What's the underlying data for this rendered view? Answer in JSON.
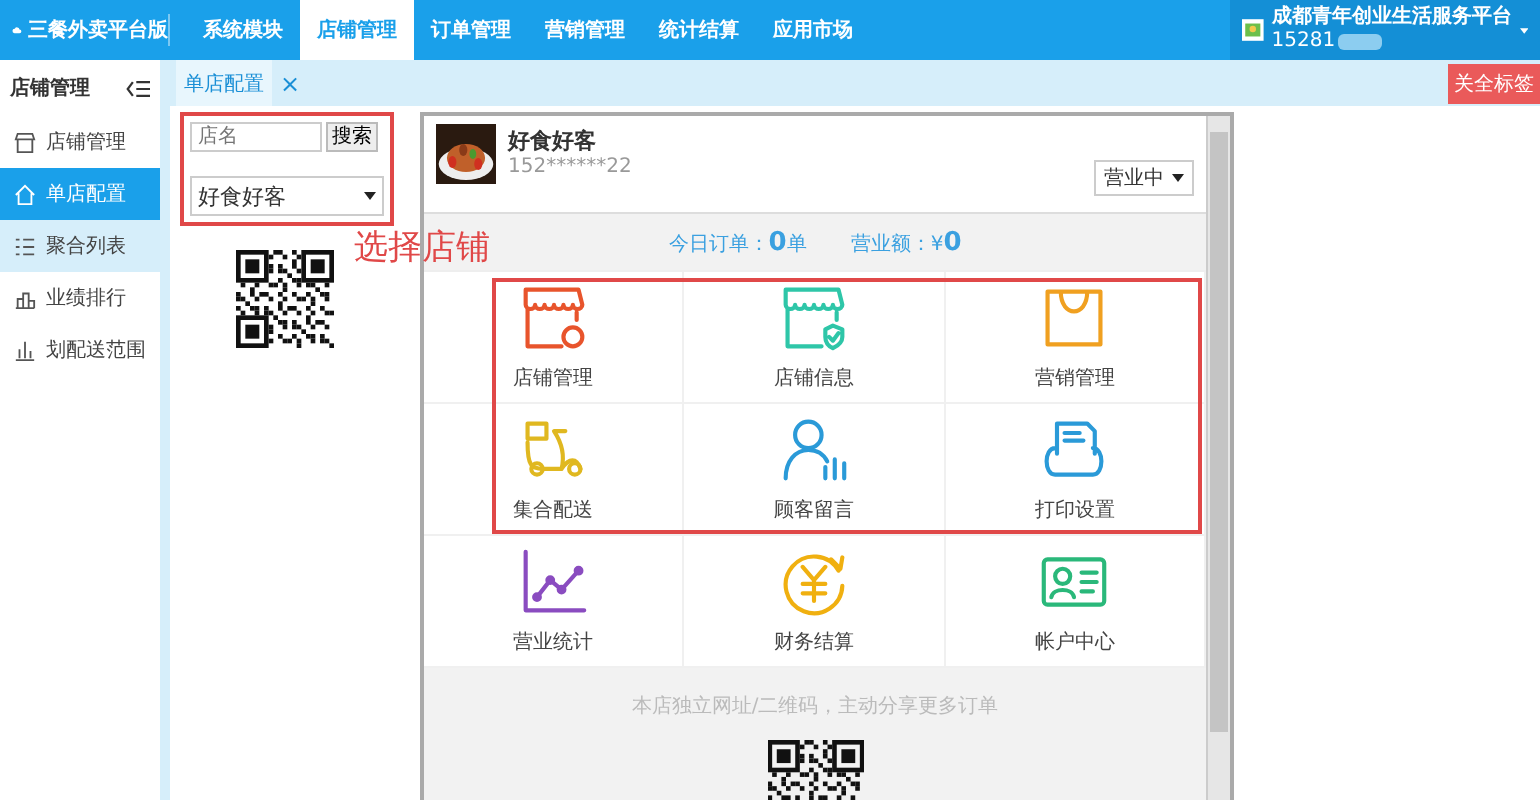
{
  "topbar": {
    "brand": "三餐外卖平台版",
    "nav": [
      {
        "label": "系统模块",
        "selected": false
      },
      {
        "label": "店铺管理",
        "selected": true
      },
      {
        "label": "订单管理",
        "selected": false
      },
      {
        "label": "营销管理",
        "selected": false
      },
      {
        "label": "统计结算",
        "selected": false
      },
      {
        "label": "应用市场",
        "selected": false
      }
    ],
    "user": {
      "name": "成都青年创业生活服务平台",
      "phone": "15281"
    }
  },
  "sidebar": {
    "title": "店铺管理",
    "items": [
      {
        "label": "店铺管理",
        "kind": "store",
        "selected": false,
        "hovered": false
      },
      {
        "label": "单店配置",
        "kind": "home",
        "selected": true,
        "hovered": false
      },
      {
        "label": "聚合列表",
        "kind": "list",
        "selected": false,
        "hovered": true
      },
      {
        "label": "业绩排行",
        "kind": "rank",
        "selected": false,
        "hovered": false
      },
      {
        "label": "划配送范围",
        "kind": "bars",
        "selected": false,
        "hovered": false
      }
    ]
  },
  "tabs": [
    {
      "label": "单店配置",
      "close": "×",
      "selected": true
    }
  ],
  "close_all": "关全标签",
  "picker": {
    "placeholder": "店名",
    "search": "搜索",
    "store": "好食好客"
  },
  "annotation": "选择店铺",
  "preview": {
    "name": "好食好客",
    "phone": "152******22",
    "status": "营业中",
    "stats": [
      {
        "label": "今日订单：",
        "value": "0",
        "unit": "单"
      },
      {
        "label": "营业额：¥",
        "value": "0"
      }
    ],
    "grid": [
      {
        "label": "店铺管理",
        "kind": "store",
        "color": "#e8542c"
      },
      {
        "label": "店铺信息",
        "kind": "shopinfo",
        "color": "#2ec6a8"
      },
      {
        "label": "营销管理",
        "kind": "bag",
        "color": "#f0a020"
      },
      {
        "label": "集合配送",
        "kind": "scooter",
        "color": "#e0b820"
      },
      {
        "label": "顾客留言",
        "kind": "customer",
        "color": "#2a9ad8"
      },
      {
        "label": "打印设置",
        "kind": "printer",
        "color": "#2a9ad8"
      },
      {
        "label": "营业统计",
        "kind": "chart",
        "color": "#8a4cc0"
      },
      {
        "label": "财务结算",
        "kind": "finance",
        "color": "#f0b010"
      },
      {
        "label": "帐户中心",
        "kind": "account",
        "color": "#2ab87a"
      }
    ],
    "footer": "本店独立网址/二维码，主动分享更多订单"
  }
}
